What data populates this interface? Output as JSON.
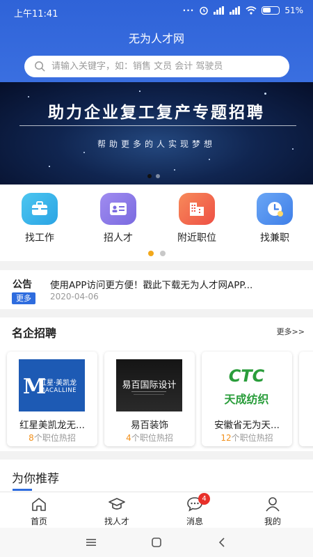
{
  "status_bar": {
    "time": "上午11:41",
    "dots": "···",
    "battery": "51%"
  },
  "header": {
    "title": "无为人才网"
  },
  "search": {
    "placeholder": "请输入关键字，如：销售 文员 会计 驾驶员"
  },
  "banner": {
    "title": "助力企业复工复产专题招聘",
    "subtitle": "帮助更多的人实现梦想"
  },
  "quick_nav": [
    {
      "label": "找工作",
      "icon": "briefcase-icon",
      "color": "#35b4e8"
    },
    {
      "label": "招人才",
      "icon": "id-card-icon",
      "color": "#8c7be8"
    },
    {
      "label": "附近职位",
      "icon": "building-icon",
      "color": "#f2664d"
    },
    {
      "label": "找兼职",
      "icon": "clock-icon",
      "color": "#4b8ff0"
    }
  ],
  "notice": {
    "label": "公告",
    "more": "更多",
    "text": "使用APP访问更方便！戳此下载无为人才网APP...",
    "date": "2020-04-06"
  },
  "companies": {
    "title": "名企招聘",
    "more": "更多>>",
    "items": [
      {
        "name": "红星美凯龙无...",
        "count": "8",
        "suffix": "个职位热招",
        "logo_cn": "红星·美凯龙",
        "logo_en": "MACALLINE",
        "logo_m": "M"
      },
      {
        "name": "易百装饰",
        "count": "4",
        "suffix": "个职位热招",
        "logo_cn": "易百国际设计"
      },
      {
        "name": "安徽省无为天...",
        "count": "12",
        "suffix": "个职位热招",
        "logo_mark": "CTC",
        "logo_cn": "天成纺织"
      }
    ]
  },
  "recommend": {
    "title": "为你推荐"
  },
  "tabbar": [
    {
      "label": "首页",
      "icon": "home-icon"
    },
    {
      "label": "找人才",
      "icon": "graduation-cap-icon"
    },
    {
      "label": "消息",
      "icon": "chat-icon",
      "badge": "4"
    },
    {
      "label": "我的",
      "icon": "user-icon"
    }
  ],
  "colors": {
    "primary": "#2f63d8",
    "accent": "#f2901b",
    "badge": "#e8302a"
  }
}
